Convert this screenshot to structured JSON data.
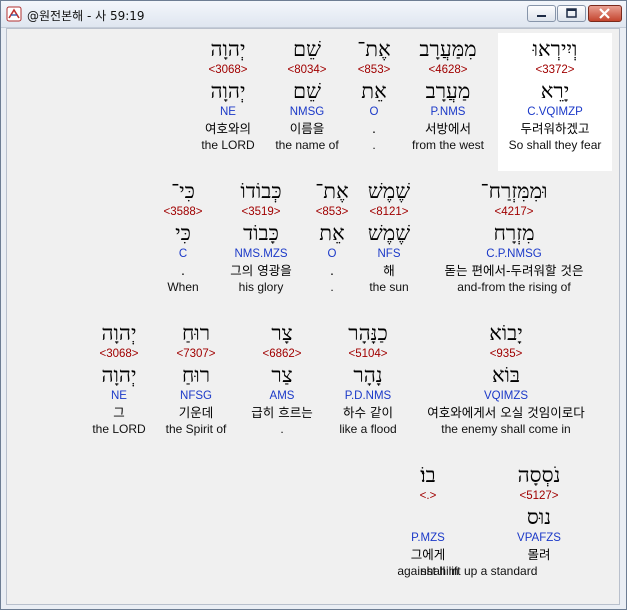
{
  "window": {
    "title": "@원전본해 - 사 59:19"
  },
  "rows": [
    {
      "words": [
        {
          "heb": "וְיִירְאוּ",
          "strong": "<3372>",
          "lemma": "יָרֵא",
          "morph": "C.VQIMZP",
          "kor": "두려워하겠고",
          "eng": "So shall they fear",
          "highlight": true
        },
        {
          "heb": "מִמַּעֲרָב",
          "strong": "<4628>",
          "lemma": "מַעֲרָב",
          "morph": "P.NMS",
          "kor": "서방에서",
          "eng": "from the west"
        },
        {
          "heb": "אֶת־",
          "strong": "<853>",
          "lemma": "אֵת",
          "morph": "O",
          "kor": ".",
          "eng": "."
        },
        {
          "heb": "שֵׁם",
          "strong": "<8034>",
          "lemma": "שֵׁם",
          "morph": "NMSG",
          "kor": "이름을",
          "eng": "the name of"
        },
        {
          "heb": "יְהוָה",
          "strong": "<3068>",
          "lemma": "יְהוָה",
          "morph": "NE",
          "kor": "여호와의",
          "eng": "the LORD"
        }
      ]
    },
    {
      "words": [
        {
          "heb": "וּמִמִּזְרַח־",
          "strong": "<4217>",
          "lemma": "מִזְרָח",
          "morph": "C.P.NMSG",
          "kor": "돋는 편에서-두려워할 것은",
          "eng": "and-from the rising of"
        },
        {
          "heb": "שֶׁמֶשׁ",
          "strong": "<8121>",
          "lemma": "שֶׁמֶשׁ",
          "morph": "NFS",
          "kor": "해",
          "eng": "the sun"
        },
        {
          "heb": "אֶת־",
          "strong": "<853>",
          "lemma": "אֵת",
          "morph": "O",
          "kor": ".",
          "eng": "."
        },
        {
          "heb": "כְּבוֹדוֹ",
          "strong": "<3519>",
          "lemma": "כָּבוֹד",
          "morph": "NMS.MZS",
          "kor": "그의 영광을",
          "eng": "his glory"
        },
        {
          "heb": "כִּי־",
          "strong": "<3588>",
          "lemma": "כִּי",
          "morph": "C",
          "kor": ".",
          "eng": "When"
        }
      ]
    },
    {
      "words": [
        {
          "heb": "יָבוֹא",
          "strong": "<935>",
          "lemma": "בּוֹא",
          "morph": "VQIMZS",
          "kor": "여호와에게서 오실 것임이로다",
          "eng": "the enemy shall come in"
        },
        {
          "heb": "כַנָּהָר",
          "strong": "<5104>",
          "lemma": "נָהָר",
          "morph": "P.D.NMS",
          "kor": "하수 같이",
          "eng": "like a flood"
        },
        {
          "heb": "צָר",
          "strong": "<6862>",
          "lemma": "צַר",
          "morph": "AMS",
          "kor": "급히 흐르는",
          "eng": "."
        },
        {
          "heb": "רוּחַ",
          "strong": "<7307>",
          "lemma": "רוּחַ",
          "morph": "NFSG",
          "kor": "기운데",
          "eng": "the Spirit of"
        },
        {
          "heb": "יְהוָה",
          "strong": "<3068>",
          "lemma": "יְהוָה",
          "morph": "NE",
          "kor": "그",
          "eng": "the LORD"
        }
      ]
    },
    {
      "words": [
        {
          "heb": "נֹסְסָה",
          "strong": "<5127>",
          "lemma": "נוּס",
          "morph": "VPAFZS",
          "kor": "몰려",
          "eng": "shall lift up a standard"
        },
        {
          "heb": "בוֹ׃",
          "strong": "<.>",
          "lemma": "",
          "morph": "P.MZS",
          "kor": "그에게",
          "eng": "against him"
        }
      ]
    }
  ]
}
